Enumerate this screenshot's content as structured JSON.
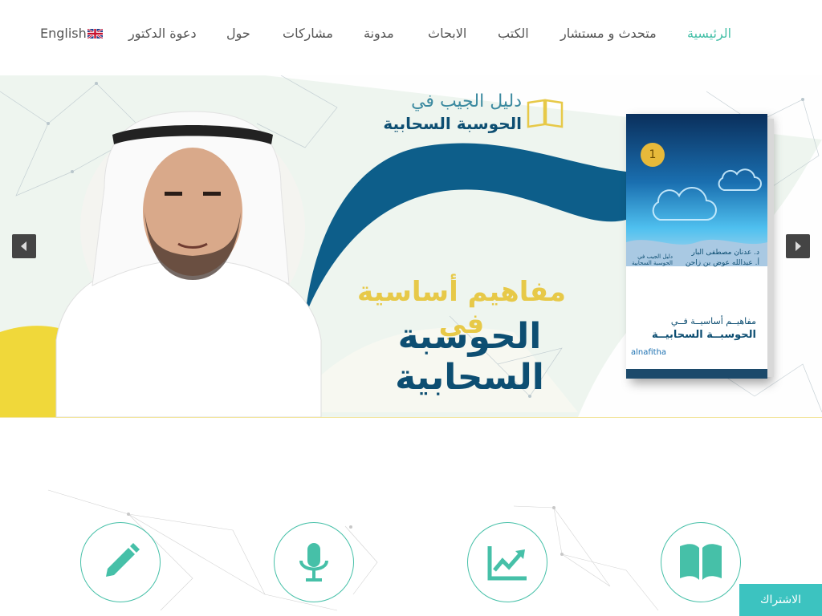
{
  "nav": {
    "items": [
      "English",
      "دعوة الدكتور",
      "حول",
      "مشاركات",
      "مدونة",
      "الابحاث",
      "الكتب",
      "متحدث و مستشار",
      "الرئيسية"
    ],
    "active_index": 8
  },
  "hero": {
    "title_line1": "دليل الجيب في",
    "title_line2": "الحوسبة السحابية",
    "headline1": "مفاهيم أساسية في",
    "headline2": "الحوسبة السحابية",
    "book": {
      "badge": "1",
      "authors_line1": "د. عدنان مصطفى البار",
      "authors_line2": "أ. عبدالله عوض بن زاحن",
      "series_label": "دليل الجيب في الحوسبة السحابية",
      "title_line1": "مفاهيــم أساسيــة فــي",
      "title_line2": "الحوسبــة السحابيــة",
      "publisher": "alnafitha"
    }
  },
  "features": {
    "icons": [
      "pencil-icon",
      "microphone-icon",
      "chart-icon",
      "book-icon"
    ]
  },
  "subscribe": {
    "label": "الاشتراك"
  },
  "colors": {
    "accent": "#46c0a8",
    "navy": "#0d4e72",
    "gold": "#e7c948",
    "subscribe_bg": "#3cc3c0"
  }
}
